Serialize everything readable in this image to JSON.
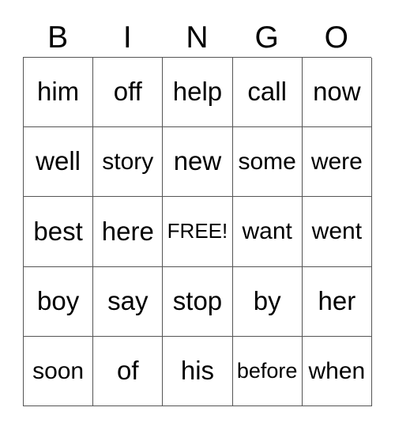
{
  "card": {
    "title": "BINGO",
    "headers": [
      "B",
      "I",
      "N",
      "G",
      "O"
    ],
    "free_space_label": "FREE!",
    "rows": [
      [
        "him",
        "off",
        "help",
        "call",
        "now"
      ],
      [
        "well",
        "story",
        "new",
        "some",
        "were"
      ],
      [
        "best",
        "here",
        "FREE!",
        "want",
        "went"
      ],
      [
        "boy",
        "say",
        "stop",
        "by",
        "her"
      ],
      [
        "soon",
        "of",
        "his",
        "before",
        "when"
      ]
    ],
    "colors": {
      "text": "#000000",
      "grid_line": "#555555",
      "background": "#ffffff"
    }
  }
}
